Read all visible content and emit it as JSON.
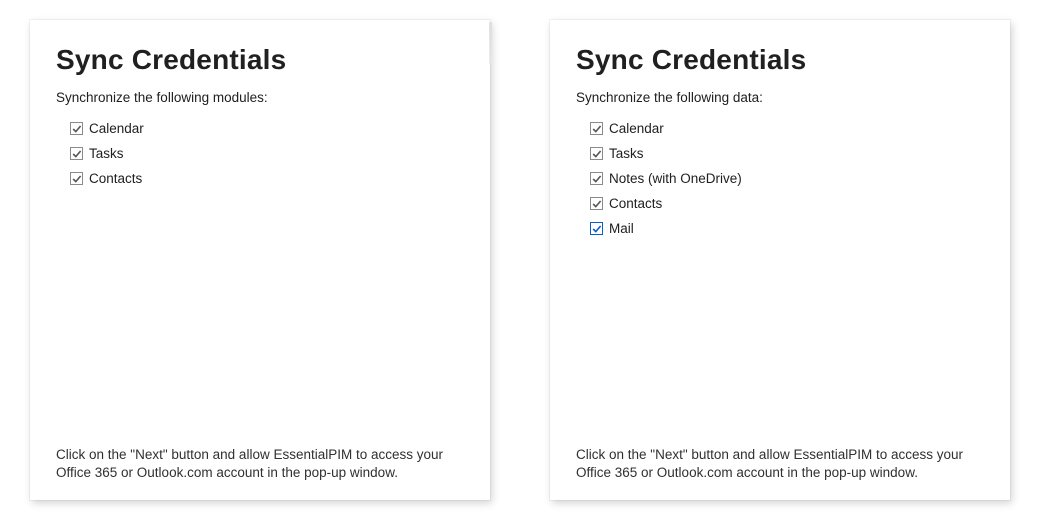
{
  "panels": [
    {
      "title": "Sync Credentials",
      "subtitle": "Synchronize the following modules:",
      "options": [
        {
          "label": "Calendar",
          "checked": true,
          "style": "gray"
        },
        {
          "label": "Tasks",
          "checked": true,
          "style": "gray"
        },
        {
          "label": "Contacts",
          "checked": true,
          "style": "gray"
        }
      ],
      "footer": "Click on the \"Next\" button and allow EssentialPIM to access your Office 365 or Outlook.com account in the pop-up window."
    },
    {
      "title": "Sync Credentials",
      "subtitle": "Synchronize the following data:",
      "options": [
        {
          "label": "Calendar",
          "checked": true,
          "style": "gray"
        },
        {
          "label": "Tasks",
          "checked": true,
          "style": "gray"
        },
        {
          "label": "Notes (with OneDrive)",
          "checked": true,
          "style": "gray"
        },
        {
          "label": "Contacts",
          "checked": true,
          "style": "gray"
        },
        {
          "label": "Mail",
          "checked": true,
          "style": "blue"
        }
      ],
      "footer": "Click on the \"Next\" button and allow EssentialPIM to access your Office 365 or Outlook.com account in the pop-up window."
    }
  ]
}
